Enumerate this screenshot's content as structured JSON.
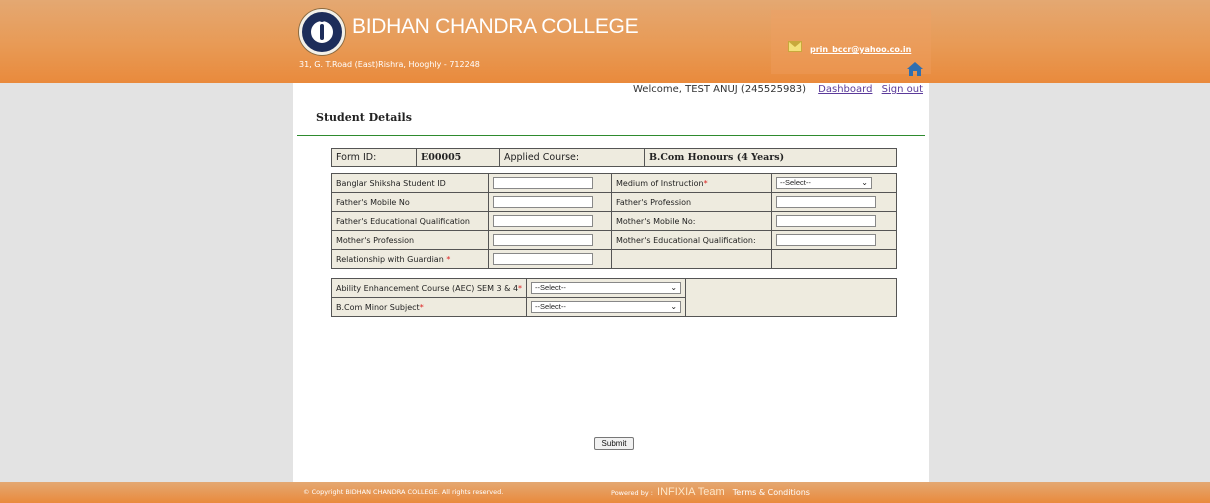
{
  "header": {
    "college_name": "BIDHAN CHANDRA COLLEGE",
    "address": "31, G. T.Road (East)Rishra, Hooghly - 712248",
    "email": "prin_bccr@yahoo.co.in",
    "home_icon": "home-icon",
    "mail_icon": "envelope-icon"
  },
  "user": {
    "welcome": "Welcome, TEST ANUJ (245525983)",
    "dashboard": "Dashboard",
    "signout": "Sign out"
  },
  "page": {
    "title": "Student Details"
  },
  "summary": {
    "form_id_label": "Form ID:",
    "form_id": "E00005",
    "course_label": "Applied Course:",
    "course": "B.Com Honours (4 Years)"
  },
  "form": {
    "banglar_shiksha_label": "Banglar Shiksha Student ID",
    "medium_label": "Medium of Instruction",
    "medium_value": "--Select--",
    "father_mobile_label": "Father's Mobile No",
    "father_profession_label": "Father's Profession",
    "father_edu_label": "Father's Educational Qualification",
    "mother_mobile_label": "Mother's Mobile No:",
    "mother_profession_label": "Mother's Profession",
    "mother_edu_label": "Mother's Educational Qualification:",
    "guardian_label": "Relationship with Guardian",
    "required_mark": "*"
  },
  "courses": {
    "aec_label": "Ability Enhancement Course (AEC) SEM 3 & 4",
    "aec_value": "--Select--",
    "minor_label": "B.Com Minor Subject",
    "minor_value": "--Select--"
  },
  "actions": {
    "submit": "Submit"
  },
  "footer": {
    "copyright": "© Copyright BIDHAN CHANDRA COLLEGE. All rights reserved.",
    "powered_by": "Powered by :",
    "brand": "INFIXIA Team",
    "terms": "Terms & Conditions"
  },
  "colors": {
    "header": "#e98a3c",
    "cell_bg": "#eeebdf",
    "rule": "#2e8b2e"
  }
}
